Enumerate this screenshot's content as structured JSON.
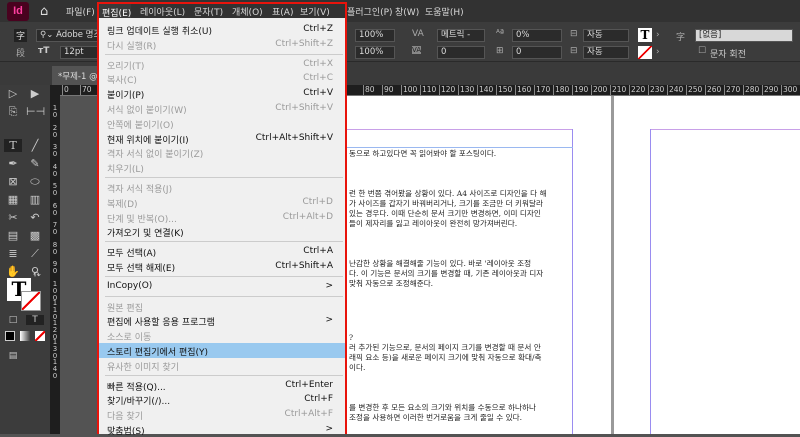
{
  "app": {
    "logo": "Id",
    "menus": [
      "파일(F)",
      "편집(E)",
      "레이아웃(L)",
      "문자(T)",
      "개체(O)",
      "표(A)",
      "보기(V)",
      "플러그인(P)",
      "창(W)",
      "도움말(H)"
    ]
  },
  "control": {
    "font_icon": "字",
    "para_icon": "段",
    "font_family": "Adobe 명조",
    "font_size": "12pt",
    "vscale": "100%",
    "hscale": "100%",
    "kerning": "메트릭 -",
    "tracking": "0",
    "baseline": "0%",
    "skew": "0",
    "leading_auto": "자동",
    "leading_auto2": "자동",
    "style": "[없음]",
    "rotate_label": "문자 회전"
  },
  "tab": {
    "title": "*무제-1 @"
  },
  "ruler": {
    "h_left": [
      "0",
      "70"
    ],
    "h": [
      "80",
      "90",
      "100",
      "110",
      "120",
      "130",
      "140",
      "150",
      "160",
      "170",
      "180",
      "190",
      "200",
      "210",
      "220",
      "230",
      "240",
      "250",
      "260",
      "270",
      "280",
      "290",
      "300"
    ],
    "v": [
      "1\n0",
      "2\n0",
      "3\n0",
      "4\n0",
      "5\n0",
      "6\n0",
      "7\n0",
      "8\n0",
      "9\n0",
      "1\n0\n0",
      "1\n1\n0",
      "1\n2\n0",
      "1\n3\n0",
      "1\n4\n0"
    ]
  },
  "menu": {
    "items": [
      {
        "label": "링크 업데이트 실행 취소(U)",
        "shortcut": "Ctrl+Z",
        "enabled": true
      },
      {
        "label": "다시 실행(R)",
        "shortcut": "Ctrl+Shift+Z",
        "enabled": false
      },
      {
        "sep": true
      },
      {
        "label": "오리기(T)",
        "shortcut": "Ctrl+X",
        "enabled": false
      },
      {
        "label": "복사(C)",
        "shortcut": "Ctrl+C",
        "enabled": false
      },
      {
        "label": "붙이기(P)",
        "shortcut": "Ctrl+V",
        "enabled": true
      },
      {
        "label": "서식 없이 붙이기(W)",
        "shortcut": "Ctrl+Shift+V",
        "enabled": false
      },
      {
        "label": "안쪽에 붙이기(O)",
        "shortcut": "",
        "enabled": false
      },
      {
        "label": "현재 위치에 붙이기(I)",
        "shortcut": "Ctrl+Alt+Shift+V",
        "enabled": true
      },
      {
        "label": "격자 서식 없이 붙이기(Z)",
        "shortcut": "",
        "enabled": false
      },
      {
        "label": "치우기(L)",
        "shortcut": "",
        "enabled": false
      },
      {
        "sep": true
      },
      {
        "label": "격자 서식 적용(J)",
        "shortcut": "",
        "enabled": false
      },
      {
        "label": "복제(D)",
        "shortcut": "Ctrl+D",
        "enabled": false
      },
      {
        "label": "단계 및 반복(O)...",
        "shortcut": "Ctrl+Alt+D",
        "enabled": false
      },
      {
        "label": "가져오기 및 연결(K)",
        "shortcut": "",
        "enabled": true
      },
      {
        "sep": true
      },
      {
        "label": "모두 선택(A)",
        "shortcut": "Ctrl+A",
        "enabled": true
      },
      {
        "label": "모두 선택 해제(E)",
        "shortcut": "Ctrl+Shift+A",
        "enabled": true
      },
      {
        "sep": true
      },
      {
        "label": "InCopy(O)",
        "shortcut": ">",
        "enabled": true
      },
      {
        "sep": true
      },
      {
        "label": "원본 편집",
        "shortcut": "",
        "enabled": false
      },
      {
        "label": "편집에 사용할 응용 프로그램",
        "shortcut": ">",
        "enabled": true
      },
      {
        "label": "소스로 이동",
        "shortcut": "",
        "enabled": false
      },
      {
        "label": "스토리 편집기에서 편집(Y)",
        "shortcut": "",
        "enabled": true,
        "highlighted": true
      },
      {
        "label": "유사한 이미지 찾기",
        "shortcut": "",
        "enabled": false
      },
      {
        "sep": true
      },
      {
        "label": "빠른 적용(Q)...",
        "shortcut": "Ctrl+Enter",
        "enabled": true
      },
      {
        "label": "찾기/바꾸기(/)...",
        "shortcut": "Ctrl+F",
        "enabled": true
      },
      {
        "label": "다음 찾기",
        "shortcut": "Ctrl+Alt+F",
        "enabled": false
      },
      {
        "label": "맞춤법(S)",
        "shortcut": ">",
        "enabled": true
      }
    ]
  },
  "doc": {
    "lines": [
      "동으로 하고있다면 꼭 읽어봐야 할 포스팅이다.",
      "런 한 번쯤 겪어봤을 상황이 있다. A4 사이즈로 디자인을 다 해",
      "가 사이즈를 갑자기 바꿔버리거나, 크기를 조금만 더 키워달라",
      "있는 경우다. 이때 단순히 문서 크기만 변경하면, 이미 디자인",
      "들이 제자리를 잃고 레이아웃이 완전히 망가져버린다.",
      "난감한 상황을 해결해줄 기능이 있다. 바로 '레이아웃 조정",
      "다. 이 기능은 문서의 크기를 변경할 때, 기존 레이아웃과 디자",
      "맞춰 자동으로 조정해준다.",
      "?",
      "러 추가된 기능으로, 문서의 페이지 크기를 변경할 때 문서 안",
      "래픽 요소 등)을 새로운 페이지 크기에 맞춰 자동으로 확대/축",
      "이다.",
      "를 변경한 후 모든 요소의 크기와 위치를 수동으로 하나하나",
      "조정을 사용하면 이러한 번거로움을 크게 줄일 수 있다."
    ]
  },
  "colors": {
    "highlight": "#99c9ef",
    "annotation": "#e8140c",
    "brand": "#49021f"
  }
}
